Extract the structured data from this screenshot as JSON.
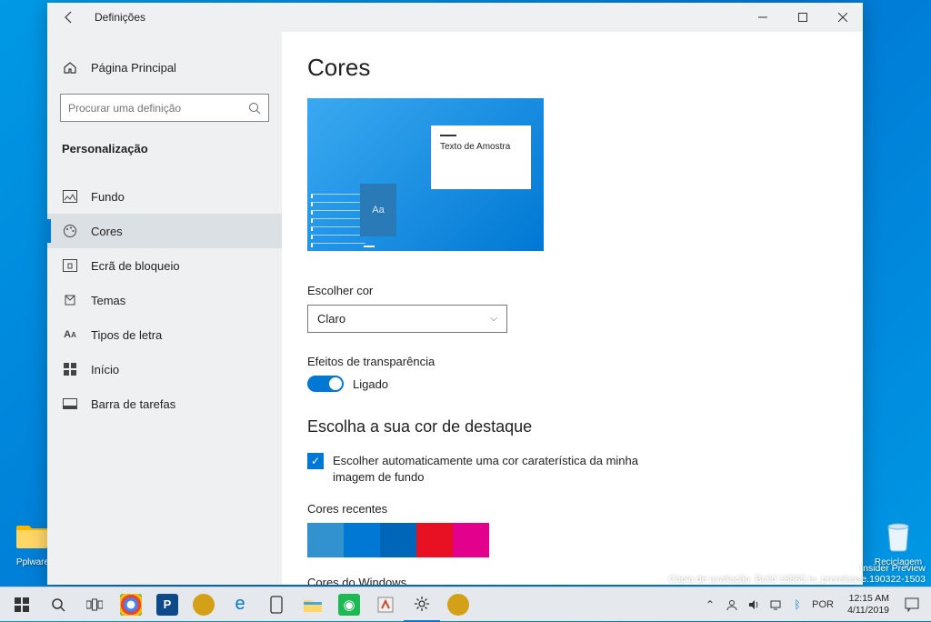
{
  "desktop": {
    "icon1_label": "Pplware",
    "icon2_label": "Reciclagem"
  },
  "window": {
    "back_title": "Definições",
    "sidebar": {
      "home": "Página Principal",
      "search_placeholder": "Procurar uma definição",
      "category": "Personalização",
      "items": [
        {
          "label": "Fundo"
        },
        {
          "label": "Cores"
        },
        {
          "label": "Ecrã de bloqueio"
        },
        {
          "label": "Temas"
        },
        {
          "label": "Tipos de letra"
        },
        {
          "label": "Início"
        },
        {
          "label": "Barra de tarefas"
        }
      ]
    },
    "content": {
      "title": "Cores",
      "sample_text": "Texto de Amostra",
      "aa": "Aa",
      "choose_color_label": "Escolher cor",
      "choose_color_value": "Claro",
      "transparency_label": "Efeitos de transparência",
      "toggle_on": "Ligado",
      "accent_heading": "Escolha a sua cor de destaque",
      "auto_checkbox": "Escolher automaticamente uma cor caraterística da minha imagem de fundo",
      "recent_label": "Cores recentes",
      "recent_colors": [
        "#3192cf",
        "#0078d4",
        "#0067b8",
        "#e81123",
        "#e3008c"
      ],
      "windows_colors_label": "Cores do Windows"
    }
  },
  "watermark": {
    "line1": "Insider Preview",
    "line2": "Cópia de avaliação. Build 18865.rs_prerelease.190322-1503"
  },
  "taskbar": {
    "lang": "POR",
    "time": "12:15 AM",
    "date": "4/11/2019"
  }
}
